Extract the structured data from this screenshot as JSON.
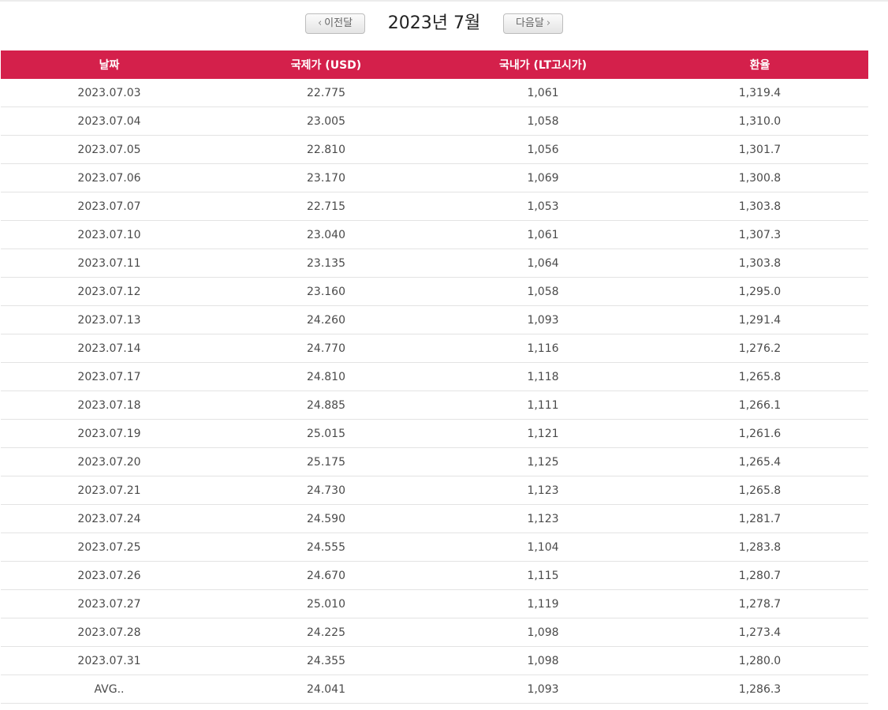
{
  "nav": {
    "prev_label": "이전달",
    "next_label": "다음달",
    "month_title": "2023년 7월"
  },
  "table": {
    "headers": [
      "날짜",
      "국제가 (USD)",
      "국내가 (LT고시가)",
      "환율"
    ],
    "rows": [
      [
        "2023.07.03",
        "22.775",
        "1,061",
        "1,319.4"
      ],
      [
        "2023.07.04",
        "23.005",
        "1,058",
        "1,310.0"
      ],
      [
        "2023.07.05",
        "22.810",
        "1,056",
        "1,301.7"
      ],
      [
        "2023.07.06",
        "23.170",
        "1,069",
        "1,300.8"
      ],
      [
        "2023.07.07",
        "22.715",
        "1,053",
        "1,303.8"
      ],
      [
        "2023.07.10",
        "23.040",
        "1,061",
        "1,307.3"
      ],
      [
        "2023.07.11",
        "23.135",
        "1,064",
        "1,303.8"
      ],
      [
        "2023.07.12",
        "23.160",
        "1,058",
        "1,295.0"
      ],
      [
        "2023.07.13",
        "24.260",
        "1,093",
        "1,291.4"
      ],
      [
        "2023.07.14",
        "24.770",
        "1,116",
        "1,276.2"
      ],
      [
        "2023.07.17",
        "24.810",
        "1,118",
        "1,265.8"
      ],
      [
        "2023.07.18",
        "24.885",
        "1,111",
        "1,266.1"
      ],
      [
        "2023.07.19",
        "25.015",
        "1,121",
        "1,261.6"
      ],
      [
        "2023.07.20",
        "25.175",
        "1,125",
        "1,265.4"
      ],
      [
        "2023.07.21",
        "24.730",
        "1,123",
        "1,265.8"
      ],
      [
        "2023.07.24",
        "24.590",
        "1,123",
        "1,281.7"
      ],
      [
        "2023.07.25",
        "24.555",
        "1,104",
        "1,283.8"
      ],
      [
        "2023.07.26",
        "24.670",
        "1,115",
        "1,280.7"
      ],
      [
        "2023.07.27",
        "25.010",
        "1,119",
        "1,278.7"
      ],
      [
        "2023.07.28",
        "24.225",
        "1,098",
        "1,273.4"
      ],
      [
        "2023.07.31",
        "24.355",
        "1,098",
        "1,280.0"
      ],
      [
        "AVG..",
        "24.041",
        "1,093",
        "1,286.3"
      ]
    ]
  },
  "colors": {
    "header_bg": "#d4204b",
    "header_text": "#ffffff",
    "row_divider": "#e3e3e3"
  },
  "icons": {
    "prev": "chevron-left-icon",
    "next": "chevron-right-icon"
  }
}
